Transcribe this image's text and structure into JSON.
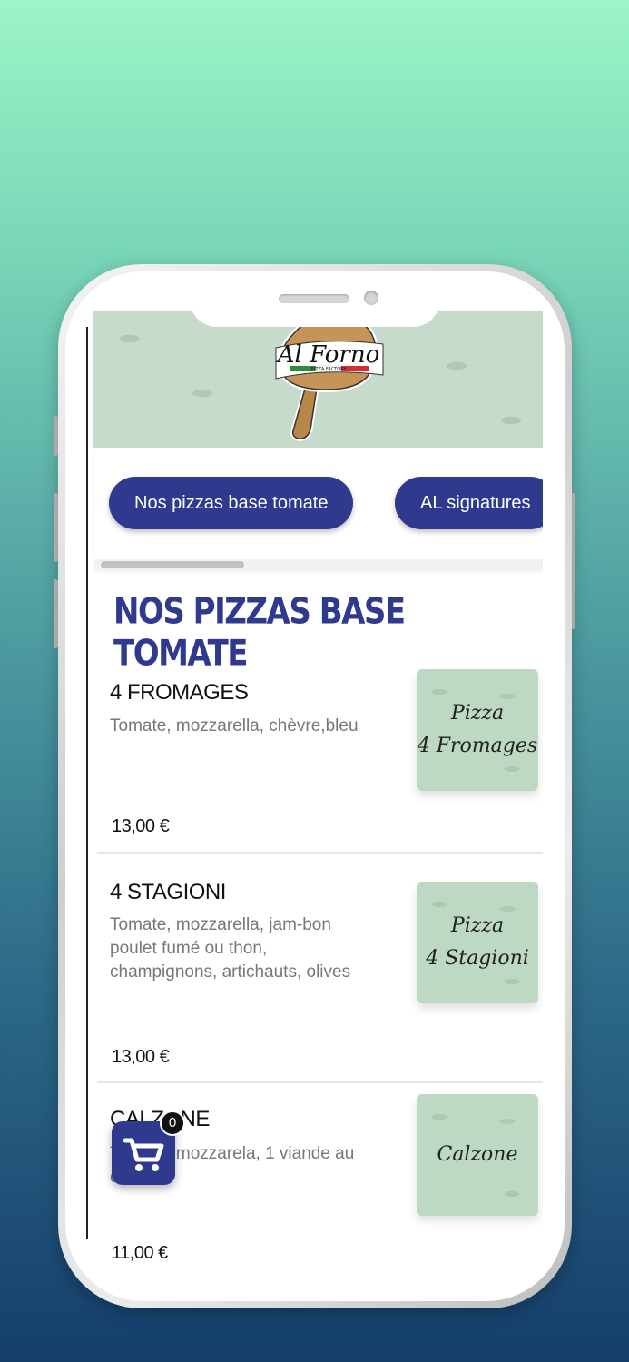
{
  "header": {
    "logo": {
      "text": "Al Forno",
      "subtext": "PIZZA FACTORY"
    }
  },
  "categories": [
    {
      "label": "Nos pizzas base tomate",
      "active": true
    },
    {
      "label": "AL signatures",
      "active": false
    }
  ],
  "section": {
    "title": "NOS PIZZAS BASE TOMATE"
  },
  "items": [
    {
      "name": "4 FROMAGES",
      "description": "Tomate, mozzarella, chèvre,bleu",
      "price": "13,00 €",
      "image_label": "Pizza\n4 Fromages"
    },
    {
      "name": "4 STAGIONI",
      "description": "Tomate, mozzarella, jam-bon poulet fumé ou thon, champignons, artichauts, olives",
      "price": "13,00 €",
      "image_label": "Pizza\n4 Stagioni"
    },
    {
      "name": "CALZONE",
      "description": "Tomate, mozzarela, 1 viande au choix.",
      "price": "11,00 €",
      "image_label": "Calzone"
    }
  ],
  "cart": {
    "count": "0",
    "icon": "cart-icon"
  },
  "colors": {
    "accent": "#2f3a8f",
    "thumb_bg": "#bdd8c3",
    "banner_bg": "#c7dbcc"
  }
}
